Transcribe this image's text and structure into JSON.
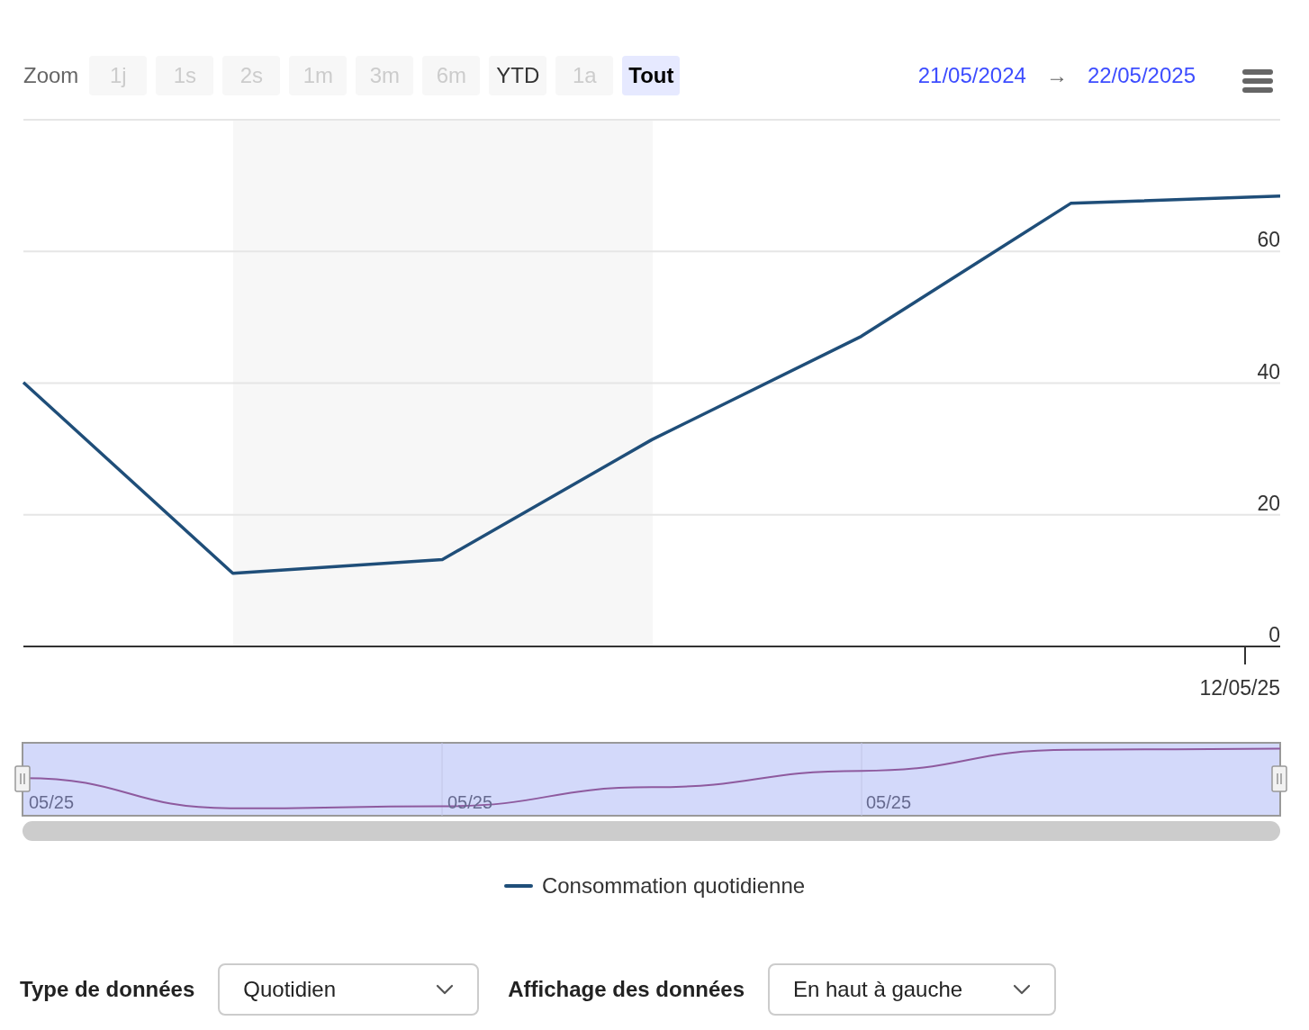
{
  "toolbar": {
    "zoom_label": "Zoom",
    "zoom_buttons": [
      {
        "label": "1j",
        "disabled": true,
        "selected": false
      },
      {
        "label": "1s",
        "disabled": true,
        "selected": false
      },
      {
        "label": "2s",
        "disabled": true,
        "selected": false
      },
      {
        "label": "1m",
        "disabled": true,
        "selected": false
      },
      {
        "label": "3m",
        "disabled": true,
        "selected": false
      },
      {
        "label": "6m",
        "disabled": true,
        "selected": false
      },
      {
        "label": "YTD",
        "disabled": false,
        "selected": false
      },
      {
        "label": "1a",
        "disabled": true,
        "selected": false
      },
      {
        "label": "Tout",
        "disabled": false,
        "selected": true
      }
    ],
    "date_from": "21/05/2024",
    "arrow": "→",
    "date_to": "22/05/2025"
  },
  "chart": {
    "chart_data": {
      "type": "line",
      "grid": true,
      "ylim": [
        0,
        80
      ],
      "yticks": [
        {
          "value": 0,
          "label": "0"
        },
        {
          "value": 20,
          "label": "20"
        },
        {
          "value": 40,
          "label": "40"
        },
        {
          "value": 60,
          "label": "60"
        }
      ],
      "series": [
        {
          "name": "Consommation quotidienne",
          "color": "#1f4e79",
          "values": [
            40.1,
            11.1,
            13.2,
            31.4,
            47.1,
            67.3,
            68.4
          ]
        }
      ],
      "annotations": [
        "12/05/25"
      ]
    }
  },
  "navigator": {
    "labels": [
      "05/25",
      "05/25",
      "05/25"
    ]
  },
  "controls": [
    {
      "label": "Type de données",
      "value": "Quotidien"
    },
    {
      "label": "Affichage des données",
      "value": "En haut à gauche"
    }
  ]
}
